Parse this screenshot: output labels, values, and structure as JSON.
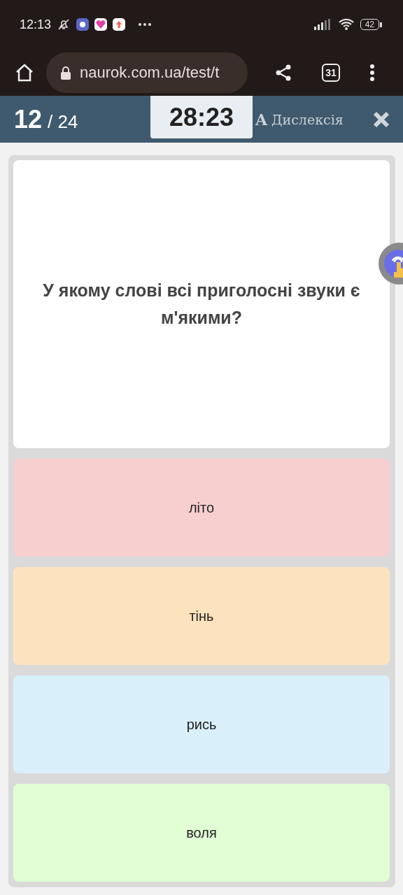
{
  "status_bar": {
    "time": "12:13",
    "battery": "42"
  },
  "browser": {
    "url": "naurok.com.ua/test/t",
    "tabs_count": "31"
  },
  "quiz_header": {
    "current": "12",
    "total": "/ 24",
    "timer": "28:23",
    "dyslexia_icon": "A",
    "dyslexia_label": "Дислексія"
  },
  "question": {
    "text": "У якому слові всі приголосні звуки є м'якими?"
  },
  "answers": [
    {
      "text": "літо",
      "color": "#f7cfcf"
    },
    {
      "text": "тінь",
      "color": "#fde3bd"
    },
    {
      "text": "рись",
      "color": "#d9f0fb"
    },
    {
      "text": "воля",
      "color": "#e1fdd3"
    }
  ]
}
